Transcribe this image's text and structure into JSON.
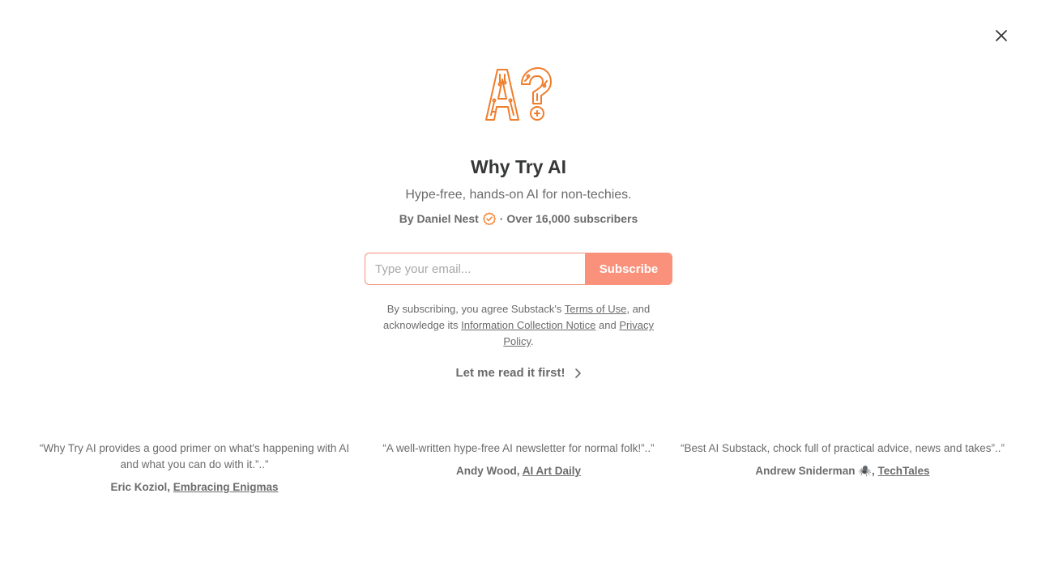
{
  "colors": {
    "accent": "#f9917b",
    "logo": "#f07d2c",
    "text_primary": "#363737",
    "text_secondary": "#6b6b6b"
  },
  "icons": {
    "close": "close-icon",
    "verified": "verified-check-icon",
    "chevron": "chevron-right-icon"
  },
  "publication": {
    "title": "Why Try AI",
    "subtitle": "Hype-free, hands-on AI for non-techies.",
    "author_prefix": "By Daniel Nest",
    "subscribers": "· Over 16,000 subscribers"
  },
  "form": {
    "email_placeholder": "Type your email...",
    "subscribe_label": "Subscribe"
  },
  "legal": {
    "text1": "By subscribing, you agree Substack's",
    "terms_link": "Terms of Use",
    "text2": ", and acknowledge its",
    "info_link": "Information Collection Notice",
    "text3": "and",
    "privacy_link": "Privacy Policy",
    "text4": "."
  },
  "read_first_label": "Let me read it first!",
  "testimonials": [
    {
      "quote": "“Why Try AI provides a good primer on what's happening with AI and what you can do with it.”..”",
      "author": "Eric Koziol,",
      "source": "Embracing Enigmas"
    },
    {
      "quote": "“A well-written hype-free AI newsletter for normal folk!”..”",
      "author": "Andy Wood,",
      "source": "AI Art Daily"
    },
    {
      "quote": "“Best AI Substack, chock full of practical advice, news and takes”..”",
      "author": "Andrew Sniderman 🕷️,",
      "source": "TechTales"
    }
  ]
}
